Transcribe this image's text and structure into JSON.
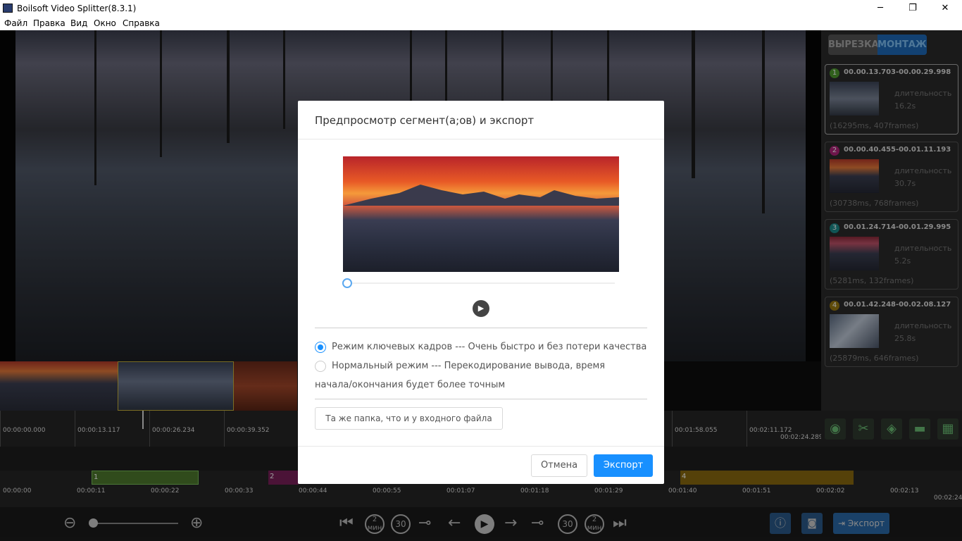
{
  "window": {
    "title": "Boilsoft Video Splitter(8.3.1)",
    "minimize": "─",
    "maximize": "❐",
    "close": "✕"
  },
  "menu": [
    "Файл",
    "Правка",
    "Вид",
    "Окно",
    "Справка"
  ],
  "mode_tabs": {
    "cut": "ВЫРЕЗКА",
    "montage": "МОНТАЖ",
    "active": "montage"
  },
  "segments": [
    {
      "num": "1",
      "color": "#4e9a2e",
      "range": "00.00.13.703-00.00.29.998",
      "duration_label": "длительность",
      "duration": "16.2s",
      "info": "(16295ms, 407frames)"
    },
    {
      "num": "2",
      "color": "#b0237a",
      "range": "00.00.40.455-00.01.11.193",
      "duration_label": "длительность",
      "duration": "30.7s",
      "info": "(30738ms, 768frames)"
    },
    {
      "num": "3",
      "color": "#1a8a8a",
      "range": "00.01.24.714-00.01.29.995",
      "duration_label": "длительность",
      "duration": "5.2s",
      "info": "(5281ms, 132frames)"
    },
    {
      "num": "4",
      "color": "#9a7a10",
      "range": "00.01.42.248-00.02.08.127",
      "duration_label": "длительность",
      "duration": "25.8s",
      "info": "(25879ms, 646frames)"
    }
  ],
  "ruler_top": [
    "00:00:00.000",
    "00:00:13.117",
    "00:00:26.234",
    "00:00:39.352",
    "00:01:58.055",
    "00:02:11.172",
    "00:02:24.289"
  ],
  "ruler_bottom": [
    "00:00:00",
    "00:00:11",
    "00:00:22",
    "00:00:33",
    "00:00:44",
    "00:00:55",
    "00:01:07",
    "00:01:18",
    "00:01:29",
    "00:01:40",
    "00:01:51",
    "00:02:02",
    "00:02:13",
    "00:02:24"
  ],
  "segment_bars": [
    {
      "label": "1",
      "color": "#4e7a2e"
    },
    {
      "label": "2",
      "color": "#7a1f5a"
    },
    {
      "label": "4",
      "color": "#8a6a10"
    }
  ],
  "controls": {
    "zoom_out": "zoom-out",
    "zoom_in": "zoom-in",
    "export_label": "Экспорт",
    "skip_back_2": "2",
    "skip_back_2_unit": "мин",
    "skip_back_30": "30",
    "skip_fwd_30": "30",
    "skip_fwd_2": "2",
    "skip_fwd_2_unit": "мин"
  },
  "dialog": {
    "title": "Предпросмотр сегмент(а;ов) и экспорт",
    "keyframe_mode": "Режим ключевых кадров --- Очень быстро и без потери качества",
    "normal_mode_line1": "Нормальный режим --- Перекодирование вывода, время",
    "normal_mode_line2": "начала/окончания будет более точным",
    "selected_mode": "keyframe",
    "folder_label": "Та же папка, что и у входного файла",
    "cancel_label": "Отмена",
    "export_label": "Экспорт",
    "play_icon": "▶"
  }
}
